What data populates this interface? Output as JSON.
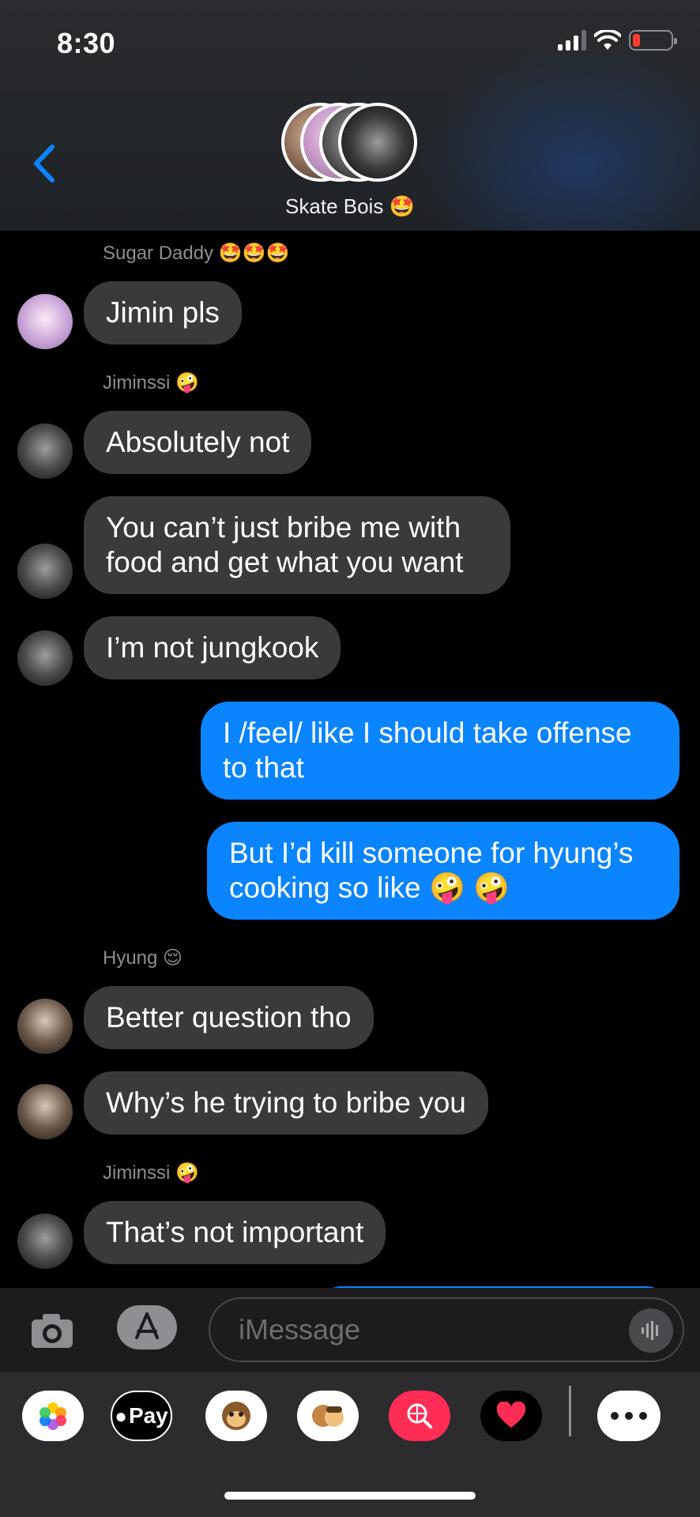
{
  "status": {
    "time": "8:30"
  },
  "header": {
    "group_name": "Skate Bois 🤩"
  },
  "messages": [
    {
      "sender": "Sugar Daddy 🤩🤩🤩",
      "text": "Jimin pls"
    },
    {
      "sender": "Jiminssi 🤪",
      "text": "Absolutely not"
    },
    {
      "text": "You can’t just bribe me with food and get what you want"
    },
    {
      "text": "I’m not jungkook"
    },
    {
      "text": "I /feel/ like I should take offense to that"
    },
    {
      "text": "But I’d kill someone for hyung’s cooking so like 🤪 🤪"
    },
    {
      "sender": "Hyung 😌",
      "text": "Better question tho"
    },
    {
      "text": "Why’s he trying to bribe you"
    },
    {
      "sender": "Jiminssi 🤪",
      "text": "That’s not important"
    }
  ],
  "input": {
    "placeholder": "iMessage"
  },
  "drawer": {
    "pay_label": "Pay"
  },
  "colors": {
    "outgoing": "#0a84ff",
    "incoming": "#3a3a3c",
    "accent": "#0a84ff"
  }
}
